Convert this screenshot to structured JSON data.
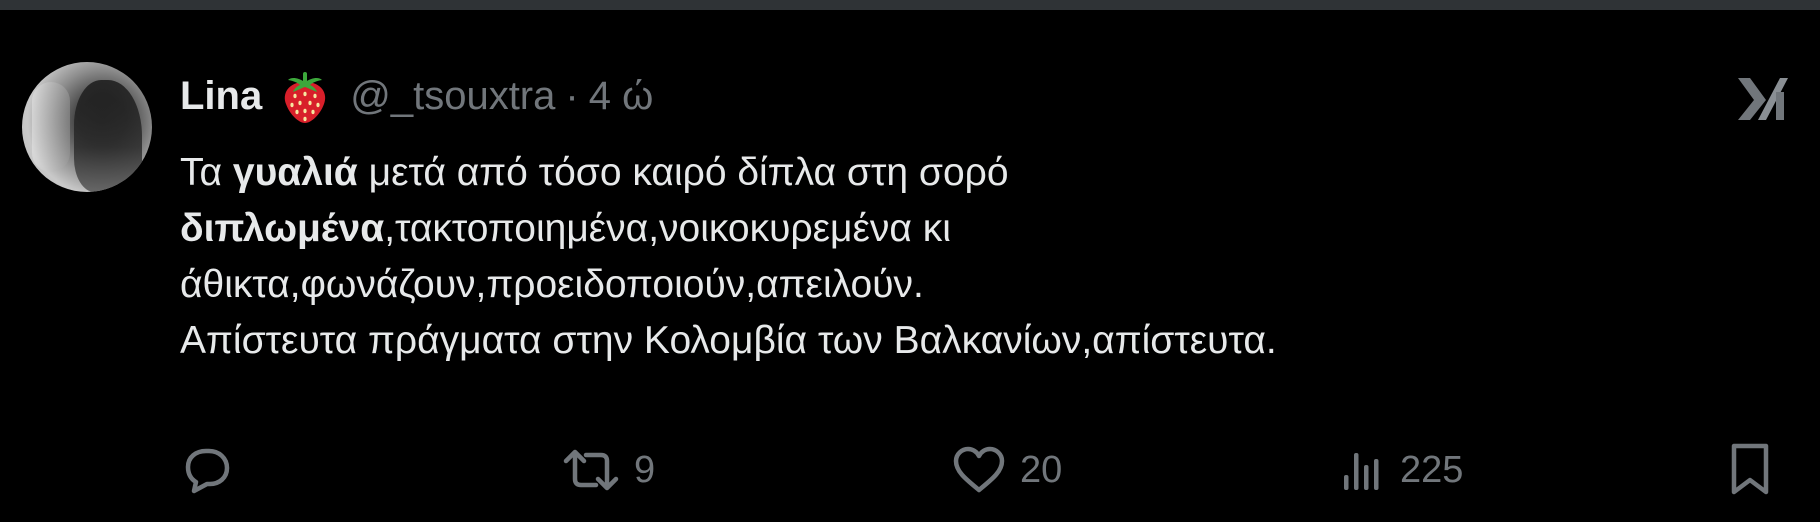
{
  "tweet": {
    "author": {
      "display_name": "Lina",
      "emoji": "strawberry-icon",
      "handle": "@_tsouxtra",
      "separator": "·",
      "time": "4 ώ"
    },
    "text": {
      "line1": {
        "pre": "Τα ",
        "bold": "γυαλιά",
        "post": " μετά από τόσο καιρό δίπλα στη σορό"
      },
      "line2": {
        "bold": "διπλωμένα",
        "post": ",τακτοποιημένα,νοικοκυρεμένα κι"
      },
      "line3": "άθικτα,φωνάζουν,προειδοποιούν,απειλούν.",
      "line4": "Απίστευτα πράγματα στην Κολομβία των Βαλκανίων,απίστευτα."
    },
    "actions": {
      "reply_icon": "reply-icon",
      "retweet_icon": "retweet-icon",
      "retweet_count": "9",
      "like_icon": "heart-icon",
      "like_count": "20",
      "views_icon": "views-icon",
      "views_count": "225",
      "bookmark_icon": "bookmark-icon"
    },
    "brand_icon": "x-logo-icon"
  },
  "colors": {
    "background": "#000000",
    "text_primary": "#e7e9ea",
    "text_secondary": "#71767b",
    "divider": "#2f3336"
  }
}
